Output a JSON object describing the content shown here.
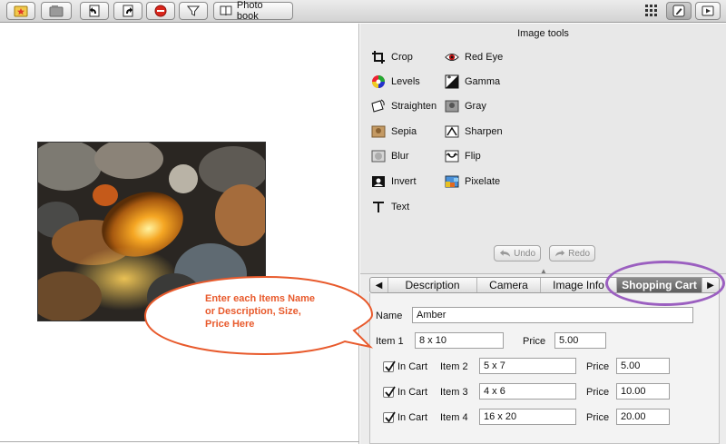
{
  "toolbar": {
    "photo_book_label": "Photo book",
    "buttons": [
      "star-folder-icon",
      "folder-icon",
      "rotate-left-icon",
      "rotate-right-icon",
      "stop-icon",
      "filter-icon"
    ],
    "right_buttons": [
      "grid-view-icon",
      "edit-icon",
      "slideshow-icon"
    ]
  },
  "image_tools": {
    "title": "Image tools",
    "tools": [
      {
        "label": "Crop",
        "icon": "crop-icon"
      },
      {
        "label": "Red Eye",
        "icon": "red-eye-icon"
      },
      {
        "label": "Levels",
        "icon": "levels-icon"
      },
      {
        "label": "Gamma",
        "icon": "gamma-icon"
      },
      {
        "label": "Straighten",
        "icon": "straighten-icon"
      },
      {
        "label": "Gray",
        "icon": "gray-icon"
      },
      {
        "label": "Sepia",
        "icon": "sepia-icon"
      },
      {
        "label": "Sharpen",
        "icon": "sharpen-icon"
      },
      {
        "label": "Blur",
        "icon": "blur-icon"
      },
      {
        "label": "Flip",
        "icon": "flip-icon"
      },
      {
        "label": "Invert",
        "icon": "invert-icon"
      },
      {
        "label": "Pixelate",
        "icon": "pixelate-icon"
      },
      {
        "label": "Text",
        "icon": "text-icon"
      }
    ],
    "undo_label": "Undo",
    "redo_label": "Redo"
  },
  "tabs": {
    "items": [
      "Description",
      "Camera",
      "Image Info",
      "Shopping Cart"
    ],
    "active": "Shopping Cart"
  },
  "cart": {
    "name_label": "Name",
    "name_value": "Amber",
    "item1": {
      "label": "Item 1",
      "size": "8 x 10",
      "price_label": "Price",
      "price": "5.00"
    },
    "items": [
      {
        "in_cart_label": "In Cart",
        "checked": true,
        "label": "Item 2",
        "size": "5 x 7",
        "price_label": "Price",
        "price": "5.00"
      },
      {
        "in_cart_label": "In Cart",
        "checked": true,
        "label": "Item 3",
        "size": "4 x 6",
        "price_label": "Price",
        "price": "10.00"
      },
      {
        "in_cart_label": "In Cart",
        "checked": true,
        "label": "Item 4",
        "size": "16 x 20",
        "price_label": "Price",
        "price": "20.00"
      }
    ]
  },
  "annotation": {
    "text": "Enter each Items Name or Description, Size, Price Here",
    "color": "#e85a2c",
    "highlight_color": "#9b5fc0"
  }
}
